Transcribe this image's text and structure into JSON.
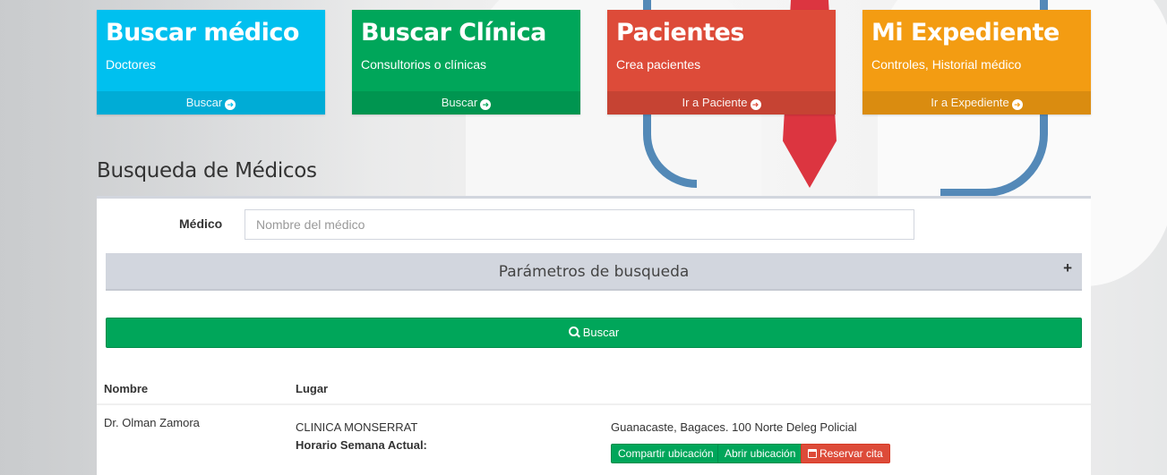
{
  "tiles": [
    {
      "title": "Buscar médico",
      "subtitle": "Doctores",
      "action": "Buscar",
      "icon": "arrow-circle-right-icon",
      "color": "#00c0ef"
    },
    {
      "title": "Buscar Clínica",
      "subtitle": "Consultorios o clínicas",
      "action": "Buscar",
      "icon": "arrow-circle-right-icon",
      "color": "#00a65a"
    },
    {
      "title": "Pacientes",
      "subtitle": "Crea pacientes",
      "action": "Ir a Paciente",
      "icon": "arrow-circle-right-icon",
      "color": "#dd4b39"
    },
    {
      "title": "Mi Expediente",
      "subtitle": "Controles, Historial médico",
      "action": "Ir a Expediente",
      "icon": "arrow-circle-right-icon",
      "color": "#f39c12"
    }
  ],
  "section_title": "Busqueda de Médicos",
  "form": {
    "medico_label": "Médico",
    "medico_placeholder": "Nombre del médico",
    "medico_value": "",
    "params_label": "Parámetros de busqueda",
    "params_toggle": "+",
    "search_button": "Buscar"
  },
  "table": {
    "headers": [
      "Nombre",
      "Lugar"
    ],
    "rows": [
      {
        "nombre": "Dr. Olman Zamora",
        "clinica": "CLINICA MONSERRAT",
        "horario_label": "Horario Semana Actual:",
        "direccion": "Guanacaste, Bagaces. 100 Norte Deleg Policial",
        "actions": [
          "Compartir ubicación",
          "Abrir ubicación",
          "Reservar cita"
        ]
      }
    ]
  },
  "colors": {
    "success": "#00a65a",
    "danger": "#dd4b39",
    "info": "#00c0ef",
    "warning": "#f39c12"
  }
}
